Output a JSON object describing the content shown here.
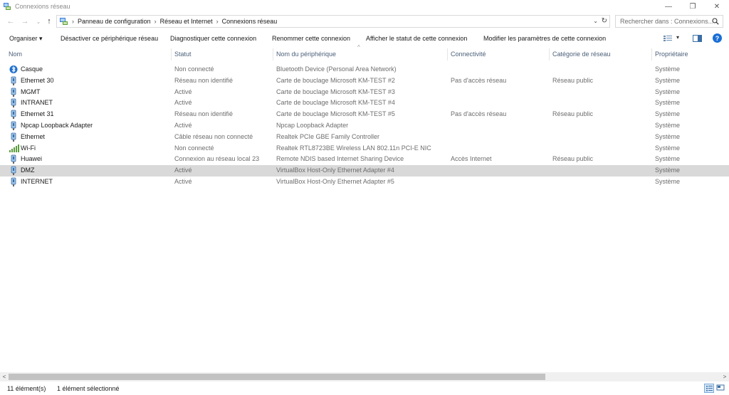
{
  "window": {
    "title": "Connexions réseau",
    "controls": {
      "minimize": "—",
      "restore": "❐",
      "close": "✕"
    }
  },
  "nav": {
    "back": "←",
    "forward": "→",
    "recent": "⌄",
    "up": "↑"
  },
  "address": {
    "breadcrumbs": [
      "Panneau de configuration",
      "Réseau et Internet",
      "Connexions réseau"
    ],
    "separator": "›",
    "dropdown": "⌄",
    "refresh": "↻"
  },
  "search": {
    "placeholder": "Rechercher dans : Connexions..."
  },
  "commands": {
    "organize": "Organiser ▾",
    "disable": "Désactiver ce périphérique réseau",
    "diagnose": "Diagnostiquer cette connexion",
    "rename": "Renommer cette connexion",
    "status": "Afficher le statut de cette connexion",
    "settings": "Modifier les paramètres de cette connexion",
    "view_dropdown": "▾",
    "help": "?"
  },
  "columns": {
    "name": "Nom",
    "status": "Statut",
    "device": "Nom du périphérique",
    "connectivity": "Connectivité",
    "category": "Catégorie de réseau",
    "owner": "Propriétaire",
    "sort_indicator": "^"
  },
  "rows": [
    {
      "name": "Casque",
      "status": "Non connecté",
      "device": "Bluetooth Device (Personal Area Network)",
      "connectivity": "",
      "category": "",
      "owner": "Système",
      "icon": "bluetooth-icon"
    },
    {
      "name": "Ethernet 30",
      "status": "Réseau non identifié",
      "device": "Carte de bouclage Microsoft KM-TEST #2",
      "connectivity": "Pas d'accès réseau",
      "category": "Réseau public",
      "owner": "Système",
      "icon": "network-adapter-icon"
    },
    {
      "name": "MGMT",
      "status": "Activé",
      "device": "Carte de bouclage Microsoft KM-TEST #3",
      "connectivity": "",
      "category": "",
      "owner": "Système",
      "icon": "network-adapter-icon"
    },
    {
      "name": "INTRANET",
      "status": "Activé",
      "device": "Carte de bouclage Microsoft KM-TEST #4",
      "connectivity": "",
      "category": "",
      "owner": "Système",
      "icon": "network-adapter-icon"
    },
    {
      "name": "Ethernet 31",
      "status": "Réseau non identifié",
      "device": "Carte de bouclage Microsoft KM-TEST #5",
      "connectivity": "Pas d'accès réseau",
      "category": "Réseau public",
      "owner": "Système",
      "icon": "network-adapter-icon"
    },
    {
      "name": "Npcap Loopback Adapter",
      "status": "Activé",
      "device": "Npcap Loopback Adapter",
      "connectivity": "",
      "category": "",
      "owner": "Système",
      "icon": "network-adapter-icon"
    },
    {
      "name": "Ethernet",
      "status": "Câble réseau non connecté",
      "device": "Realtek PCIe GBE Family Controller",
      "connectivity": "",
      "category": "",
      "owner": "Système",
      "icon": "network-adapter-icon"
    },
    {
      "name": "Wi-Fi",
      "status": "Non connecté",
      "device": "Realtek RTL8723BE Wireless LAN 802.11n PCI-E NIC",
      "connectivity": "",
      "category": "",
      "owner": "Système",
      "icon": "wifi-signal-icon"
    },
    {
      "name": "Huawei",
      "status": "Connexion au réseau local  23",
      "device": "Remote NDIS based Internet Sharing Device",
      "connectivity": "Accès Internet",
      "category": "Réseau public",
      "owner": "Système",
      "icon": "network-adapter-icon"
    },
    {
      "name": "DMZ",
      "status": "Activé",
      "device": "VirtualBox Host-Only Ethernet Adapter #4",
      "connectivity": "",
      "category": "",
      "owner": "Système",
      "icon": "network-adapter-icon",
      "selected": true
    },
    {
      "name": "INTERNET",
      "status": "Activé",
      "device": "VirtualBox Host-Only Ethernet Adapter #5",
      "connectivity": "",
      "category": "",
      "owner": "Système",
      "icon": "network-adapter-icon"
    }
  ],
  "scrollbar": {
    "left": "<",
    "right": ">"
  },
  "statusbar": {
    "count": "11 élément(s)",
    "selection": "1 élément sélectionné"
  },
  "colors": {
    "header_text": "#4c607a",
    "selected_row": "#d9d9d9",
    "help_blue": "#1a6fd6"
  }
}
